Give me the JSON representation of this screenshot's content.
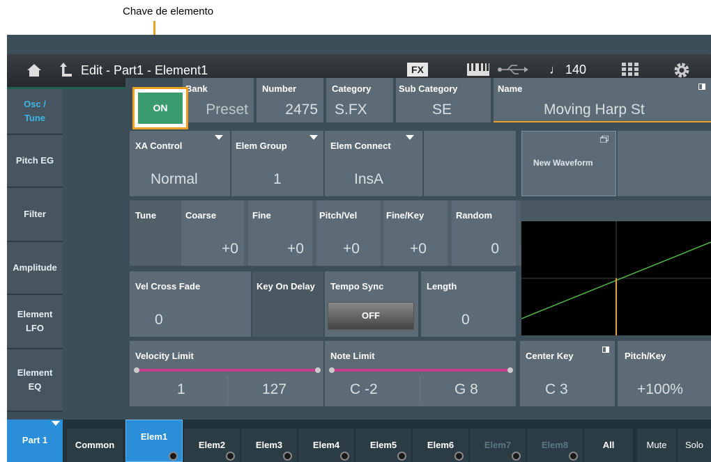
{
  "caption": "Chave de elemento",
  "header": {
    "title": "Edit - Part1 - Element1",
    "fx": "FX",
    "tempo": "♩ 140"
  },
  "tabs": [
    "Osc /\nTune",
    "Pitch EG",
    "Filter",
    "Amplitude",
    "Element\nLFO",
    "Element\nEQ"
  ],
  "element_switch": "ON",
  "top_row": {
    "bank_label": "Bank",
    "bank_value": "Preset",
    "number_label": "Number",
    "number_value": "2475",
    "category_label": "Category",
    "category_value": "S.FX",
    "subcategory_label": "Sub Category",
    "subcategory_value": "SE",
    "name_label": "Name",
    "name_value": "Moving Harp St"
  },
  "row2": {
    "xa_label": "XA Control",
    "xa_value": "Normal",
    "group_label": "Elem Group",
    "group_value": "1",
    "connect_label": "Elem Connect",
    "connect_value": "InsA",
    "wave_label": "New Waveform"
  },
  "tune": {
    "tune_label": "Tune",
    "coarse_label": "Coarse",
    "coarse_value": "+0",
    "fine_label": "Fine",
    "fine_value": "+0",
    "pv_label": "Pitch/Vel",
    "pv_value": "+0",
    "fk_label": "Fine/Key",
    "fk_value": "+0",
    "random_label": "Random",
    "random_value": "0"
  },
  "row4": {
    "vcf_label": "Vel Cross Fade",
    "vcf_value": "0",
    "kod_label": "Key On Delay",
    "tempo_label": "Tempo Sync",
    "tempo_value": "OFF",
    "length_label": "Length",
    "length_value": "0"
  },
  "row5": {
    "vel_label": "Velocity Limit",
    "vel_lo": "1",
    "vel_hi": "127",
    "note_label": "Note Limit",
    "note_lo": "C -2",
    "note_hi": "G 8",
    "center_label": "Center Key",
    "center_value": "C 3",
    "pk_label": "Pitch/Key",
    "pk_value": "+100%"
  },
  "bottom": {
    "part": "Part 1",
    "common": "Common",
    "elems": [
      "Elem1",
      "Elem2",
      "Elem3",
      "Elem4",
      "Elem5",
      "Elem6",
      "Elem7",
      "Elem8"
    ],
    "all": "All",
    "mute": "Mute",
    "solo": "Solo"
  },
  "colors": {
    "accent": "#f0a020",
    "on_green": "#3a9b6f",
    "blue": "#2a8fd8",
    "magenta": "#c83c8c"
  }
}
